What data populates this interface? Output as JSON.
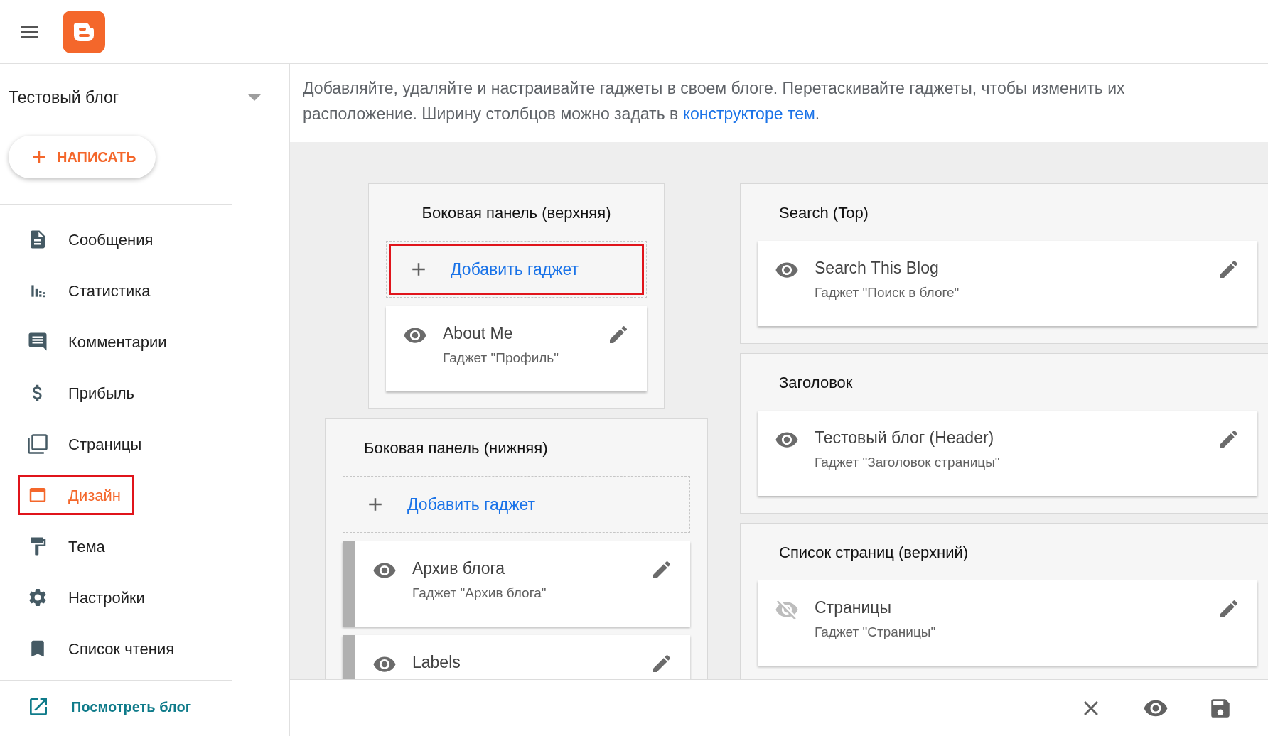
{
  "sidebar": {
    "blog_name": "Тестовый блог",
    "compose_button": "НАПИСАТЬ",
    "items": [
      {
        "label": "Сообщения",
        "selected": false,
        "highlighted": false
      },
      {
        "label": "Статистика",
        "selected": false,
        "highlighted": false
      },
      {
        "label": "Комментарии",
        "selected": false,
        "highlighted": false
      },
      {
        "label": "Прибыль",
        "selected": false,
        "highlighted": false
      },
      {
        "label": "Страницы",
        "selected": false,
        "highlighted": false
      },
      {
        "label": "Дизайн",
        "selected": true,
        "highlighted": true
      },
      {
        "label": "Тема",
        "selected": false,
        "highlighted": false
      },
      {
        "label": "Настройки",
        "selected": false,
        "highlighted": false
      },
      {
        "label": "Список чтения",
        "selected": false,
        "highlighted": false
      }
    ],
    "view_blog_link": "Посмотреть блог"
  },
  "intro": {
    "text": "Добавляйте, удаляйте и настраивайте гаджеты в своем блоге. Перетаскивайте гаджеты, чтобы изменить их расположение. Ширину столбцов можно задать в ",
    "link": "конструкторе тем",
    "after": "."
  },
  "columns": [
    {
      "sections": [
        {
          "title": "Боковая панель (верхняя)",
          "narrow": true,
          "add_gadget": {
            "label": "Добавить гаджет",
            "highlighted": true
          },
          "gadgets": [
            {
              "title": "About Me",
              "subtitle": "Гаджет \"Профиль\"",
              "visible": true,
              "draggable": false
            }
          ]
        },
        {
          "title": "Боковая панель (нижняя)",
          "narrow": false,
          "add_gadget": {
            "label": "Добавить гаджет",
            "highlighted": false
          },
          "gadgets": [
            {
              "title": "Архив блога",
              "subtitle": "Гаджет \"Архив блога\"",
              "visible": true,
              "draggable": true
            },
            {
              "title": "Labels",
              "visible": true,
              "draggable": true
            }
          ]
        }
      ]
    },
    {
      "sections": [
        {
          "title": "Search (Top)",
          "narrow": false,
          "gadgets": [
            {
              "title": "Search This Blog",
              "subtitle": "Гаджет \"Поиск в блоге\"",
              "visible": true,
              "draggable": false
            }
          ]
        },
        {
          "title": "Заголовок",
          "narrow": false,
          "gadgets": [
            {
              "title": "Тестовый блог (Header)",
              "subtitle": "Гаджет \"Заголовок страницы\"",
              "visible": true,
              "draggable": false
            }
          ]
        },
        {
          "title": "Список страниц (верхний)",
          "narrow": false,
          "gadgets": [
            {
              "title": "Страницы",
              "subtitle": "Гаджет \"Страницы\"",
              "visible": false,
              "draggable": false
            }
          ]
        }
      ]
    }
  ]
}
